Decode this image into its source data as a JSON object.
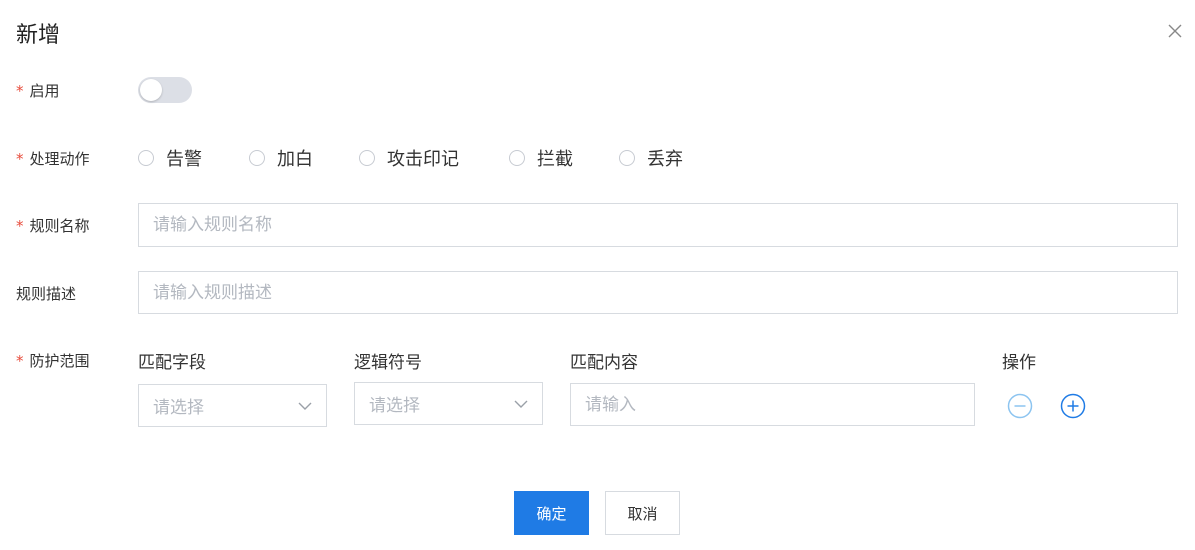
{
  "dialog": {
    "title": "新增",
    "close_icon": "close-icon"
  },
  "form": {
    "required_mark": "*",
    "enable": {
      "label": "启用",
      "value": false
    },
    "action": {
      "label": "处理动作",
      "options": [
        "告警",
        "加白",
        "攻击印记",
        "拦截",
        "丢弃"
      ]
    },
    "rule_name": {
      "label": "规则名称",
      "placeholder": "请输入规则名称",
      "value": ""
    },
    "rule_desc": {
      "label": "规则描述",
      "placeholder": "请输入规则描述",
      "value": ""
    },
    "scope": {
      "label": "防护范围",
      "columns": {
        "field": "匹配字段",
        "logic": "逻辑符号",
        "content": "匹配内容",
        "ops": "操作"
      },
      "field_placeholder": "请选择",
      "logic_placeholder": "请选择",
      "content_placeholder": "请输入"
    }
  },
  "buttons": {
    "confirm": "确定",
    "cancel": "取消"
  },
  "colors": {
    "primary": "#1f7be5",
    "required": "#e74c3c",
    "minus_disabled": "#8cc4f0"
  }
}
